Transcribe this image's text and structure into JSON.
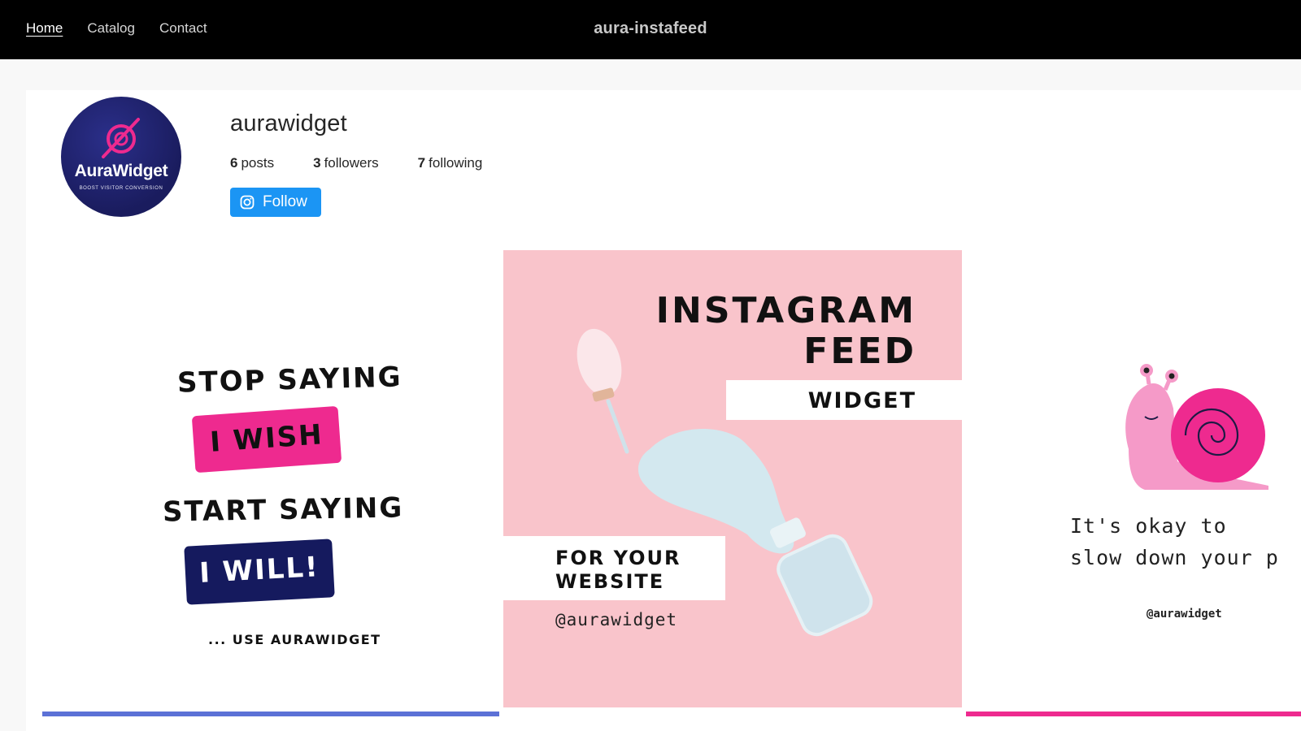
{
  "header": {
    "nav": [
      {
        "label": "Home",
        "active": true
      },
      {
        "label": "Catalog",
        "active": false
      },
      {
        "label": "Contact",
        "active": false
      }
    ],
    "store_name": "aura-instafeed"
  },
  "profile": {
    "avatar": {
      "wordmark": "AuraWidget",
      "tagline": "BOOST VISITOR CONVERSION"
    },
    "username": "aurawidget",
    "stats": [
      {
        "count": "6",
        "label": "posts"
      },
      {
        "count": "3",
        "label": "followers"
      },
      {
        "count": "7",
        "label": "following"
      }
    ],
    "follow_label": "Follow"
  },
  "posts": [
    {
      "line1": "STOP SAYING",
      "highlight1": "I WISH",
      "line2": "START SAYING",
      "highlight2": "I WILL!",
      "footer": "... USE AURAWIDGET"
    },
    {
      "title_line1": "INSTAGRAM",
      "title_line2": "FEED",
      "band_top": "WIDGET",
      "band_bottom": "FOR YOUR\nWEBSITE",
      "handle": "@aurawidget"
    },
    {
      "caption": "It's okay to\nslow down your p",
      "handle": "@aurawidget"
    }
  ],
  "colors": {
    "header_bg": "#000000",
    "follow_button": "#1b95f4",
    "pink_accent": "#ee2a8f",
    "navy_accent": "#151a5e",
    "post2_bg": "#f9c4cb"
  }
}
